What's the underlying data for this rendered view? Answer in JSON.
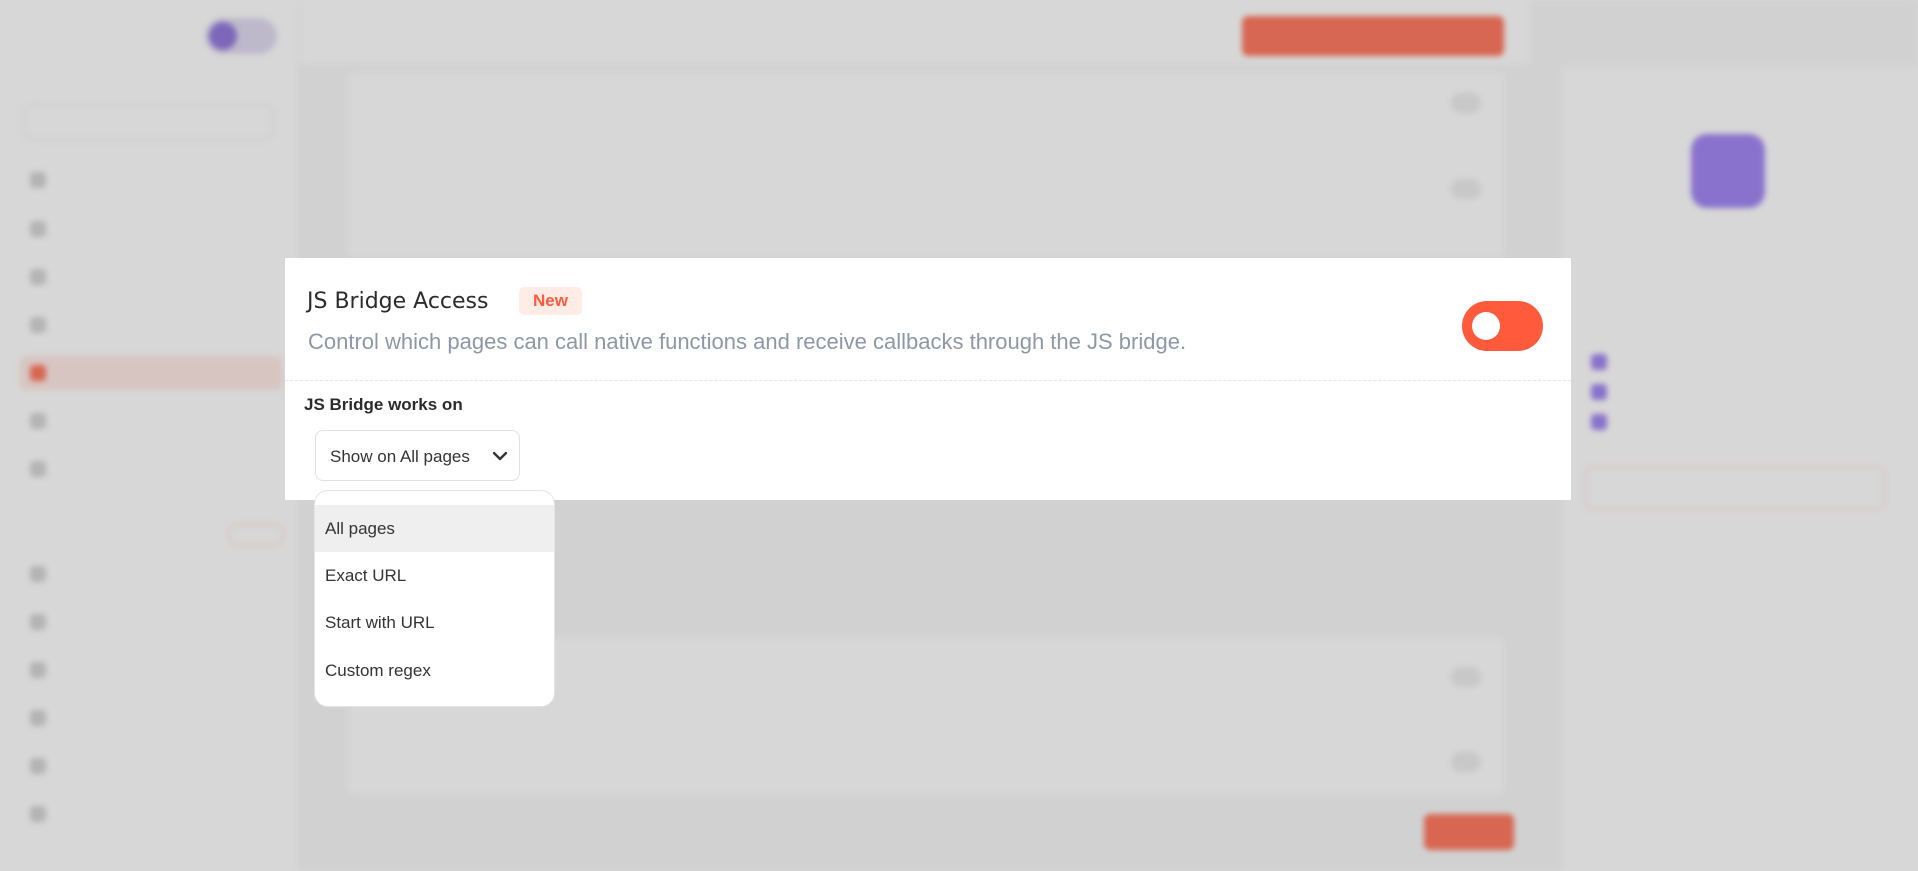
{
  "modal": {
    "title": "JS Bridge Access",
    "badge": "New",
    "description": "Control which pages can call native functions and receive callbacks through the JS bridge.",
    "toggle_state": "off",
    "works_on_label": "JS Bridge works on",
    "select_value": "Show on All pages",
    "options": [
      {
        "label": "All pages",
        "selected": true
      },
      {
        "label": "Exact URL",
        "selected": false
      },
      {
        "label": "Start with URL",
        "selected": false
      },
      {
        "label": "Custom regex",
        "selected": false
      }
    ]
  },
  "colors": {
    "accent": "#ff5a3c",
    "badge_bg": "#ffece7",
    "description_text": "#8e97a6",
    "selected_option_bg": "#efefef"
  },
  "icons": {
    "select_caret": "chevron-down-icon"
  }
}
